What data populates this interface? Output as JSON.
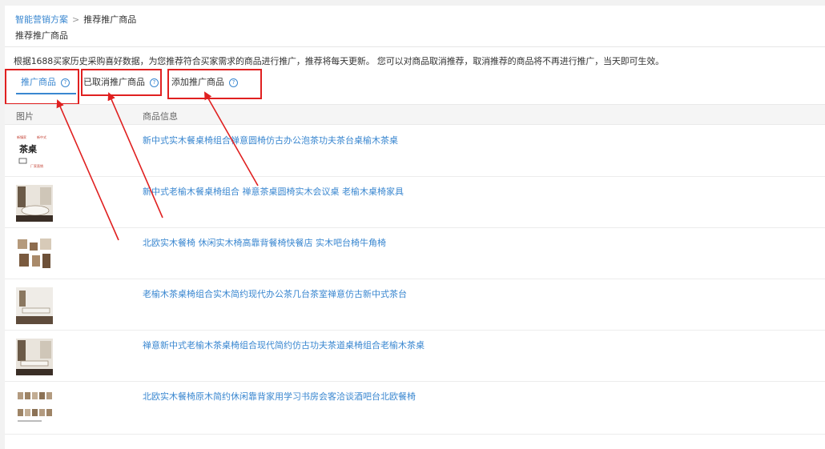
{
  "breadcrumb": {
    "root": "智能营销方案",
    "separator": ">",
    "current": "推荐推广商品"
  },
  "page_title": "推荐推广商品",
  "description": "根据1688买家历史采购喜好数据，为您推荐符合买家需求的商品进行推广，推荐将每天更新。 您可以对商品取消推荐，取消推荐的商品将不再进行推广，当天即可生效。",
  "tabs": [
    {
      "label": "推广商品",
      "help": "?",
      "active": true
    },
    {
      "label": "已取消推广商品",
      "help": "?",
      "active": false
    },
    {
      "label": "添加推广商品",
      "help": "?",
      "active": false
    }
  ],
  "table": {
    "headers": {
      "image": "图片",
      "info": "商品信息"
    },
    "rows": [
      {
        "title": "新中式实木餐桌椅组合禅意圆椅仿古办公泡茶功夫茶台桌榆木茶桌",
        "thumb_text": {
          "top_left": "新镇家",
          "top_right": "新中式",
          "main": "茶桌",
          "tag": "厂家直销"
        }
      },
      {
        "title": "新中式老榆木餐桌椅组合 禅意茶桌圆椅实木会议桌 老榆木桌椅家具"
      },
      {
        "title": "北欧实木餐椅 休闲实木椅高靠背餐椅快餐店 实木吧台椅牛角椅"
      },
      {
        "title": "老榆木茶桌椅组合实木简约现代办公茶几台茶室禅意仿古新中式茶台"
      },
      {
        "title": "禅意新中式老榆木茶桌椅组合现代简约仿古功夫茶道桌椅组合老榆木茶桌"
      },
      {
        "title": "北欧实木餐椅原木简约休闲靠背家用学习书房会客洽谈酒吧台北欧餐椅"
      }
    ]
  },
  "colors": {
    "link": "#3a87d0",
    "annotation": "#e02020",
    "header_bg": "#f5f5f5"
  }
}
